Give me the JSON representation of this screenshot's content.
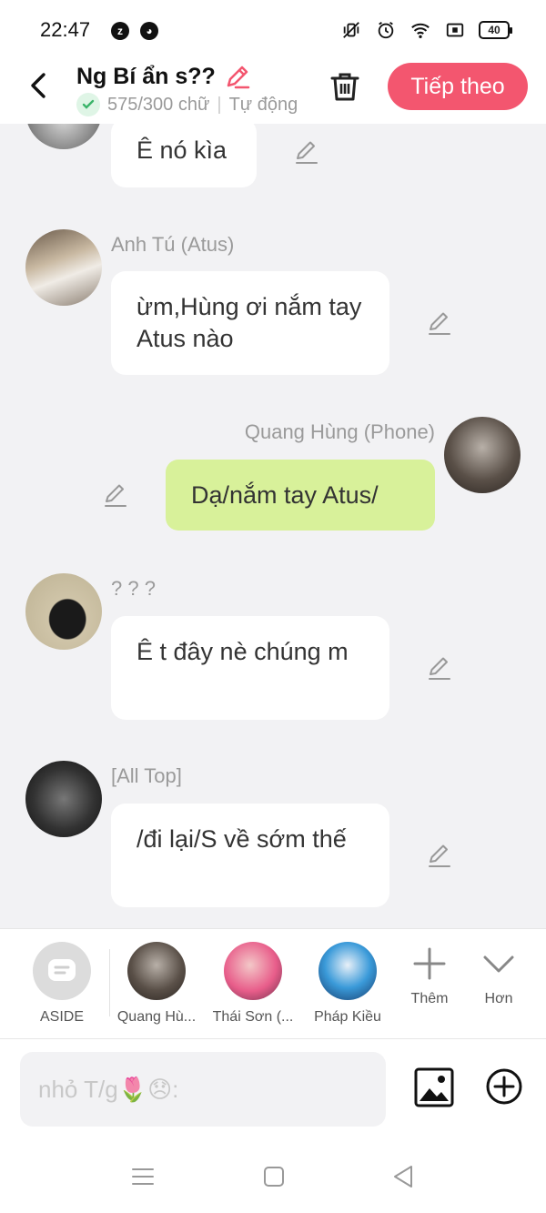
{
  "status": {
    "time": "22:47",
    "battery": "40"
  },
  "header": {
    "title": "Ng Bí ẩn s??",
    "subtitle": "575/300 chữ",
    "mode": "Tự động",
    "next_button": "Tiếp theo"
  },
  "messages": [
    {
      "sender": "",
      "text": "Ê nó kìa",
      "side": "left"
    },
    {
      "sender": "Anh Tú (Atus)",
      "text": "ừm,Hùng ơi nắm tay Atus nào",
      "side": "left"
    },
    {
      "sender": "Quang Hùng (Phone)",
      "text": "Dạ/nắm tay Atus/",
      "side": "right"
    },
    {
      "sender": "? ? ?",
      "text": "Ê t đây nè chúng m",
      "side": "left"
    },
    {
      "sender": "[All Top]",
      "text": "/đi lại/S về sớm thế",
      "side": "left"
    }
  ],
  "roles": {
    "aside": "ASIDE",
    "items": [
      "Quang Hù...",
      "Thái Sơn (...",
      "Pháp Kiều"
    ],
    "add": "Thêm",
    "more": "Hơn"
  },
  "input": {
    "placeholder": "nhỏ T/g🌷😞:"
  },
  "colors": {
    "accent": "#f3566f",
    "my_bubble": "#d8f19a"
  }
}
